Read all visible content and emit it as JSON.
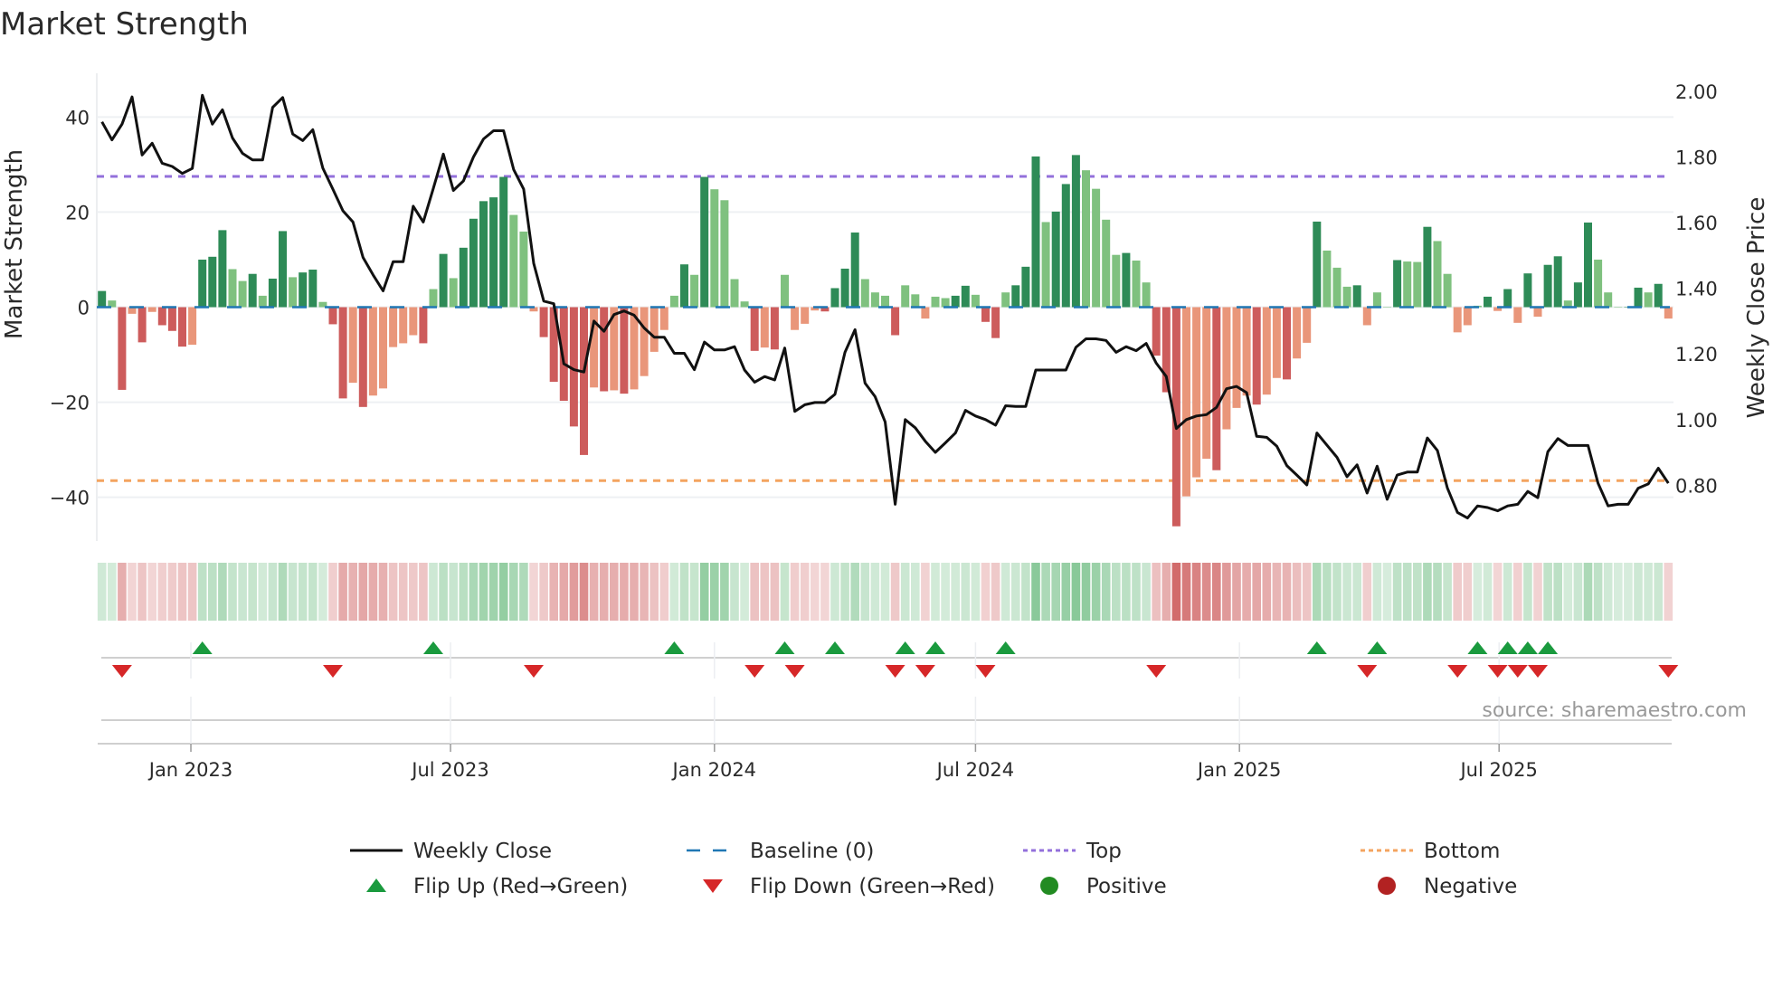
{
  "chart_data": {
    "type": "bar",
    "title": "Market Strength",
    "ylabel": "Market Strength",
    "y2label": "Weekly Close Price",
    "ylim": [
      -49.2,
      49.2
    ],
    "y2lim": [
      0.63,
      2.055
    ],
    "yticks": [
      40,
      20,
      0,
      -20,
      -40
    ],
    "yticklabels": [
      "40",
      "20",
      "0",
      "−20",
      "−40"
    ],
    "y2ticks": [
      2.0,
      1.8,
      1.6,
      1.4,
      1.2,
      1.0,
      0.8
    ],
    "y2ticklabels": [
      "2.00",
      "1.80",
      "1.60",
      "1.40",
      "1.20",
      "1.00",
      "0.80"
    ],
    "x_start": "2022-10-31",
    "x_step_days": 7,
    "xticks": [
      {
        "label": "Jan 2023",
        "date": "2023-01-01"
      },
      {
        "label": "Jul 2023",
        "date": "2023-07-01"
      },
      {
        "label": "Jan 2024",
        "date": "2024-01-01"
      },
      {
        "label": "Jul 2024",
        "date": "2024-07-01"
      },
      {
        "label": "Jan 2025",
        "date": "2025-01-01"
      },
      {
        "label": "Jul 2025",
        "date": "2025-07-01"
      }
    ],
    "top_level": 27.5,
    "bottom_level": -36.5,
    "baseline": 0,
    "strength": [
      3.4,
      1.4,
      -17.4,
      -1.4,
      -7.4,
      -1,
      -3.8,
      -5,
      -8.3,
      -7.9,
      10,
      10.6,
      16.2,
      8,
      5.5,
      7,
      2.4,
      6,
      16,
      6.3,
      7.3,
      7.9,
      1.1,
      -3.6,
      -19.2,
      -15.9,
      -21,
      -18.6,
      -17.1,
      -8.4,
      -7.6,
      -5.9,
      -7.6,
      3.8,
      11.2,
      6.1,
      12.5,
      18.6,
      22.3,
      23.1,
      27.4,
      19.4,
      15.9,
      -0.9,
      -6.3,
      -15.7,
      -19.7,
      -25.1,
      -31.1,
      -16.9,
      -17.7,
      -17.5,
      -18.2,
      -17.3,
      -14.5,
      -9.4,
      -4.8,
      2.4,
      9,
      6.8,
      27.4,
      24.8,
      22.5,
      5.9,
      1.2,
      -9.2,
      -8.5,
      -8.9,
      6.8,
      -4.8,
      -3.5,
      -0.7,
      -0.9,
      4,
      8.1,
      15.7,
      5.9,
      3.1,
      2.4,
      -5.9,
      4.6,
      2.7,
      -2.4,
      2.2,
      1.9,
      2.4,
      4.5,
      2.6,
      -3.1,
      -6.5,
      3.1,
      4.6,
      8.5,
      31.7,
      17.9,
      20.1,
      25.9,
      32,
      28.8,
      24.9,
      18.4,
      11,
      11.4,
      9.8,
      5.2,
      -10.2,
      -17.9,
      -46.1,
      -39.8,
      -35.8,
      -31.9,
      -34.3,
      -25.7,
      -21.2,
      -18.6,
      -20.5,
      -18.4,
      -14.9,
      -15.2,
      -10.8,
      -7.5,
      18,
      11.9,
      8.3,
      4.3,
      4.6,
      -3.8,
      3.1,
      0,
      9.9,
      9.6,
      9.5,
      16.9,
      13.9,
      7,
      -5.3,
      -3.8,
      0.3,
      2.2,
      -0.8,
      3.8,
      -3.3,
      7.1,
      -2,
      8.9,
      10.7,
      1.4,
      5.2,
      17.8,
      10,
      3.1,
      0,
      0,
      4.1,
      3.1,
      4.9,
      -2.4
    ],
    "weekly_close": [
      1.907,
      1.852,
      1.9,
      1.983,
      1.806,
      1.842,
      1.781,
      1.771,
      1.75,
      1.765,
      1.988,
      1.9,
      1.944,
      1.858,
      1.811,
      1.791,
      1.791,
      1.951,
      1.981,
      1.87,
      1.85,
      1.883,
      1.766,
      1.702,
      1.636,
      1.602,
      1.494,
      1.441,
      1.392,
      1.481,
      1.481,
      1.65,
      1.602,
      1.704,
      1.809,
      1.698,
      1.727,
      1.8,
      1.855,
      1.88,
      1.88,
      1.762,
      1.702,
      1.476,
      1.361,
      1.353,
      1.17,
      1.152,
      1.145,
      1.3,
      1.269,
      1.32,
      1.331,
      1.318,
      1.279,
      1.251,
      1.251,
      1.202,
      1.202,
      1.152,
      1.236,
      1.212,
      1.212,
      1.222,
      1.151,
      1.114,
      1.131,
      1.121,
      1.218,
      1.025,
      1.045,
      1.052,
      1.052,
      1.077,
      1.205,
      1.274,
      1.111,
      1.07,
      0.993,
      0.742,
      1.0,
      0.975,
      0.934,
      0.9,
      0.929,
      0.959,
      1.028,
      1.011,
      1.0,
      0.983,
      1.042,
      1.04,
      1.04,
      1.151,
      1.151,
      1.151,
      1.151,
      1.22,
      1.246,
      1.246,
      1.241,
      1.205,
      1.222,
      1.21,
      1.232,
      1.172,
      1.131,
      0.973,
      1.0,
      1.011,
      1.015,
      1.037,
      1.094,
      1.101,
      1.082,
      0.949,
      0.946,
      0.919,
      0.86,
      0.831,
      0.801,
      0.959,
      0.922,
      0.885,
      0.826,
      0.862,
      0.776,
      0.858,
      0.757,
      0.831,
      0.84,
      0.84,
      0.944,
      0.906,
      0.791,
      0.717,
      0.7,
      0.737,
      0.732,
      0.722,
      0.737,
      0.742,
      0.781,
      0.762,
      0.902,
      0.942,
      0.921,
      0.921,
      0.921,
      0.806,
      0.737,
      0.742,
      0.742,
      0.791,
      0.804,
      0.852,
      0.806
    ],
    "flip_up_weeks": [
      10,
      33,
      57,
      68,
      73,
      80,
      83,
      90,
      121,
      127,
      137,
      140,
      142,
      144
    ],
    "flip_down_weeks": [
      2,
      23,
      43,
      65,
      69,
      79,
      82,
      88,
      105,
      126,
      135,
      139,
      141,
      143,
      156
    ],
    "grid": true,
    "legend_position": "bottom",
    "legend": [
      {
        "label": "Weekly Close",
        "kind": "line"
      },
      {
        "label": "Baseline (0)",
        "kind": "baseline"
      },
      {
        "label": "Top",
        "kind": "top"
      },
      {
        "label": "Bottom",
        "kind": "bottom"
      },
      {
        "label": "Flip Up (Red→Green)",
        "kind": "up"
      },
      {
        "label": "Flip Down (Green→Red)",
        "kind": "down"
      },
      {
        "label": "Positive",
        "kind": "pos"
      },
      {
        "label": "Negative",
        "kind": "neg"
      }
    ],
    "source": "source: sharemaestro.com"
  },
  "colors": {
    "pos_strong": "#2e8b57",
    "pos_weak": "#7fc17f",
    "neg_strong": "#cd5c5c",
    "neg_weak": "#e9967a",
    "price": "#111111",
    "baseline": "#1f77b4",
    "top": "#9370db",
    "bottom": "#f4a460",
    "flip_up": "#1a9a3e",
    "flip_down": "#d62728",
    "positive": "#228b22",
    "negative": "#b22222"
  }
}
